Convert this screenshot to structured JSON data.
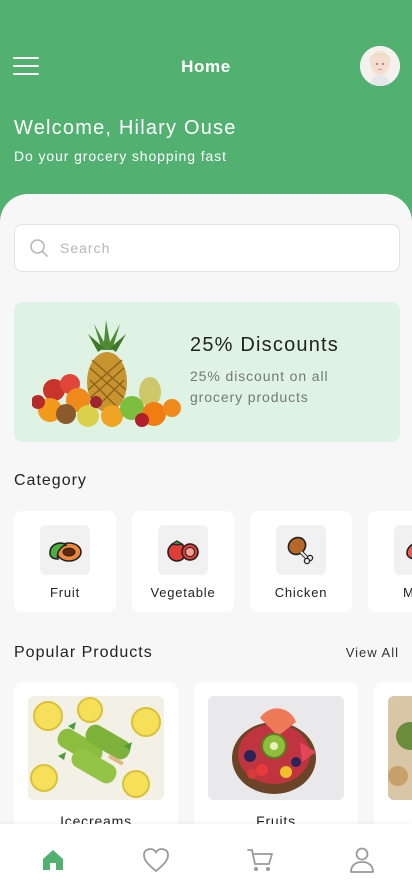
{
  "header": {
    "title": "Home",
    "welcome": "Welcome, Hilary Ouse",
    "tagline": "Do your grocery shopping fast"
  },
  "search": {
    "placeholder": "Search",
    "value": ""
  },
  "promo": {
    "title": "25% Discounts",
    "text": "25% discount on all grocery products"
  },
  "category": {
    "title": "Category",
    "items": [
      {
        "label": "Fruit",
        "icon": "papaya-icon"
      },
      {
        "label": "Vegetable",
        "icon": "tomato-icon"
      },
      {
        "label": "Chicken",
        "icon": "chicken-leg-icon"
      },
      {
        "label": "Meat",
        "icon": "meat-icon"
      }
    ]
  },
  "popular": {
    "title": "Popular Products",
    "view_all": "View All",
    "items": [
      {
        "name": "Icecreams"
      },
      {
        "name": "Fruits"
      },
      {
        "name": ""
      }
    ]
  },
  "bottom_nav": {
    "items": [
      "home-icon",
      "heart-icon",
      "cart-icon",
      "profile-icon"
    ],
    "active": "home-icon"
  },
  "colors": {
    "brand_green": "#52b171",
    "promo_bg": "#dff3e4",
    "background": "#f7f7f7"
  }
}
